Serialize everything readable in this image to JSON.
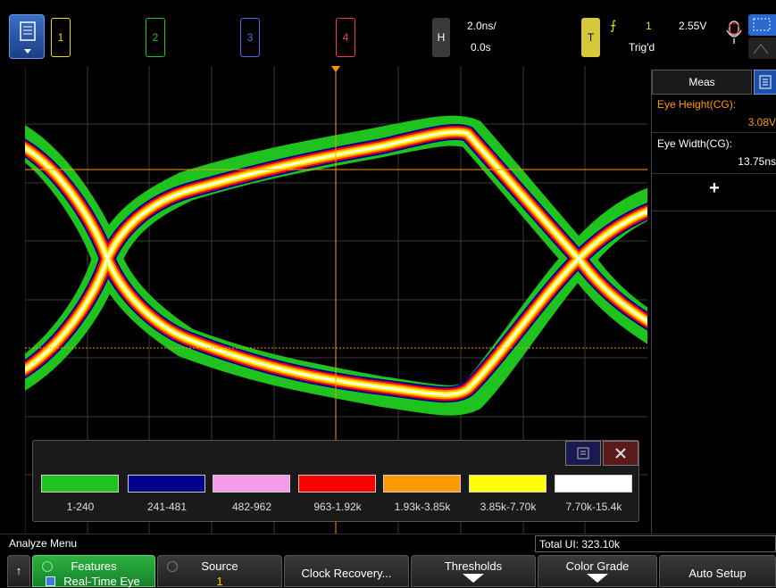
{
  "topbar": {
    "channels": [
      {
        "label": "1",
        "color": "#e7e000"
      },
      {
        "label": "2",
        "color": "#18c72c"
      },
      {
        "label": "3",
        "color": "#4a6af0"
      },
      {
        "label": "4",
        "color": "#f0347a"
      }
    ],
    "horizontal": {
      "label": "H",
      "timebase": "2.0ns/",
      "delay": "0.0s"
    },
    "trigger": {
      "label": "T",
      "edge_symbol": "⨍",
      "source": "1",
      "status": "Trig'd",
      "level": "2.55V"
    }
  },
  "legend": {
    "bins": [
      {
        "label": "1-240",
        "color": "#1ec31e"
      },
      {
        "label": "241-481",
        "color": "#00008c"
      },
      {
        "label": "482-962",
        "color": "#f49ae6"
      },
      {
        "label": "963-1.92k",
        "color": "#ff0000"
      },
      {
        "label": "1.93k-3.85k",
        "color": "#ff9900"
      },
      {
        "label": "3.85k-7.70k",
        "color": "#ffff00"
      },
      {
        "label": "7.70k-15.4k",
        "color": "#ffffff"
      }
    ],
    "menu_icon": "list-icon",
    "close_icon": "close-icon"
  },
  "side_panel": {
    "tab_label": "Meas",
    "measurements": [
      {
        "name": "Eye Height",
        "suffix": "(CG):",
        "value": "3.08V"
      },
      {
        "name": "Eye Width(CG):",
        "value": "13.75ns"
      }
    ],
    "add_symbol": "+"
  },
  "status": {
    "menu_name": "Analyze Menu",
    "total_ui": "Total UI: 323.10k"
  },
  "softkeys": {
    "back_symbol": "↑",
    "features": {
      "label": "Features",
      "value": "Real-Time Eye"
    },
    "source": {
      "label": "Source",
      "value": "1"
    },
    "clock_recovery": {
      "label": "Clock Recovery..."
    },
    "thresholds": {
      "label": "Thresholds"
    },
    "color_grade": {
      "label": "Color Grade"
    },
    "auto_setup": {
      "label": "Auto Setup"
    }
  },
  "colors": {
    "accent_orange": "#ff9900",
    "softkey_active": "#1f9c2f"
  }
}
